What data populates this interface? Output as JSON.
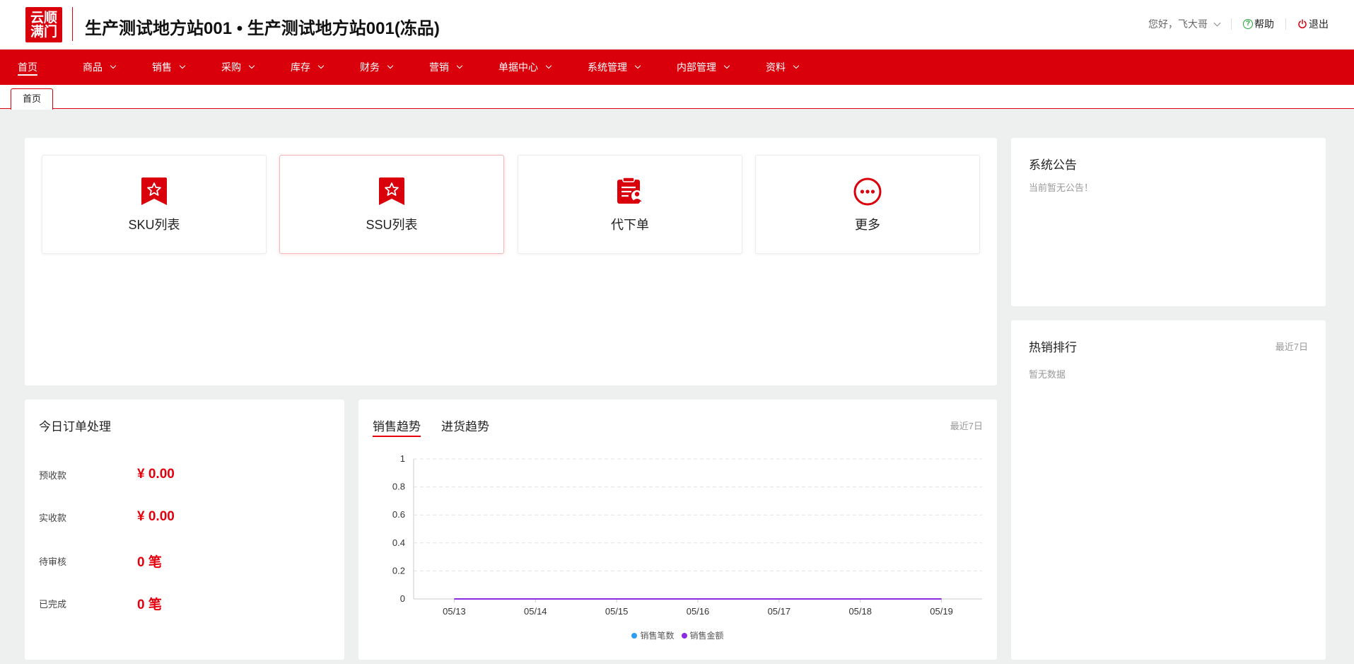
{
  "header": {
    "logo_line1": "云顺",
    "logo_line2": "满门",
    "title": "生产测试地方站001 • 生产测试地方站001(冻品)",
    "greeting": "您好，飞大哥",
    "help_label": "帮助",
    "logout_label": "退出"
  },
  "nav": {
    "items": [
      {
        "label": "首页",
        "active": true
      },
      {
        "label": "商品"
      },
      {
        "label": "销售"
      },
      {
        "label": "采购"
      },
      {
        "label": "库存"
      },
      {
        "label": "财务"
      },
      {
        "label": "营销"
      },
      {
        "label": "单据中心"
      },
      {
        "label": "系统管理"
      },
      {
        "label": "内部管理"
      },
      {
        "label": "资料"
      }
    ]
  },
  "tabs": [
    {
      "label": "首页"
    }
  ],
  "shortcuts": [
    {
      "label": "SKU列表",
      "icon": "ribbon-star-icon"
    },
    {
      "label": "SSU列表",
      "icon": "ribbon-star-icon"
    },
    {
      "label": "代下单",
      "icon": "order-person-icon"
    },
    {
      "label": "更多",
      "icon": "more-dots-icon"
    }
  ],
  "announcement": {
    "title": "系统公告",
    "empty_text": "当前暂无公告！"
  },
  "hot_sales": {
    "title": "热销排行",
    "range": "最近7日",
    "empty_text": "暂无数据"
  },
  "today_orders": {
    "title": "今日订单处理",
    "rows": [
      {
        "label": "预收款",
        "value": "¥ 0.00"
      },
      {
        "label": "实收款",
        "value": "¥ 0.00"
      },
      {
        "label": "待审核",
        "value": "0 笔"
      },
      {
        "label": "已完成",
        "value": "0 笔"
      }
    ]
  },
  "trend": {
    "tabs": [
      {
        "label": "销售趋势",
        "active": true
      },
      {
        "label": "进货趋势"
      }
    ],
    "range": "最近7日"
  },
  "colors": {
    "brand": "#d9000b",
    "value_red": "#e5000d",
    "series_count": "#2a9df4",
    "series_amount": "#8a2be2"
  },
  "chart_data": {
    "type": "line",
    "x": [
      "05/13",
      "05/14",
      "05/15",
      "05/16",
      "05/17",
      "05/18",
      "05/19"
    ],
    "yticks": [
      "0",
      "0.2",
      "0.4",
      "0.6",
      "0.8",
      "1"
    ],
    "ylim": [
      0,
      1
    ],
    "grid": true,
    "legend_position": "bottom",
    "series": [
      {
        "name": "销售笔数",
        "values": [
          0,
          0,
          0,
          0,
          0,
          0,
          0
        ],
        "color": "#2a9df4"
      },
      {
        "name": "销售金额",
        "values": [
          0,
          0,
          0,
          0,
          0,
          0,
          0
        ],
        "color": "#8a2be2"
      }
    ]
  }
}
